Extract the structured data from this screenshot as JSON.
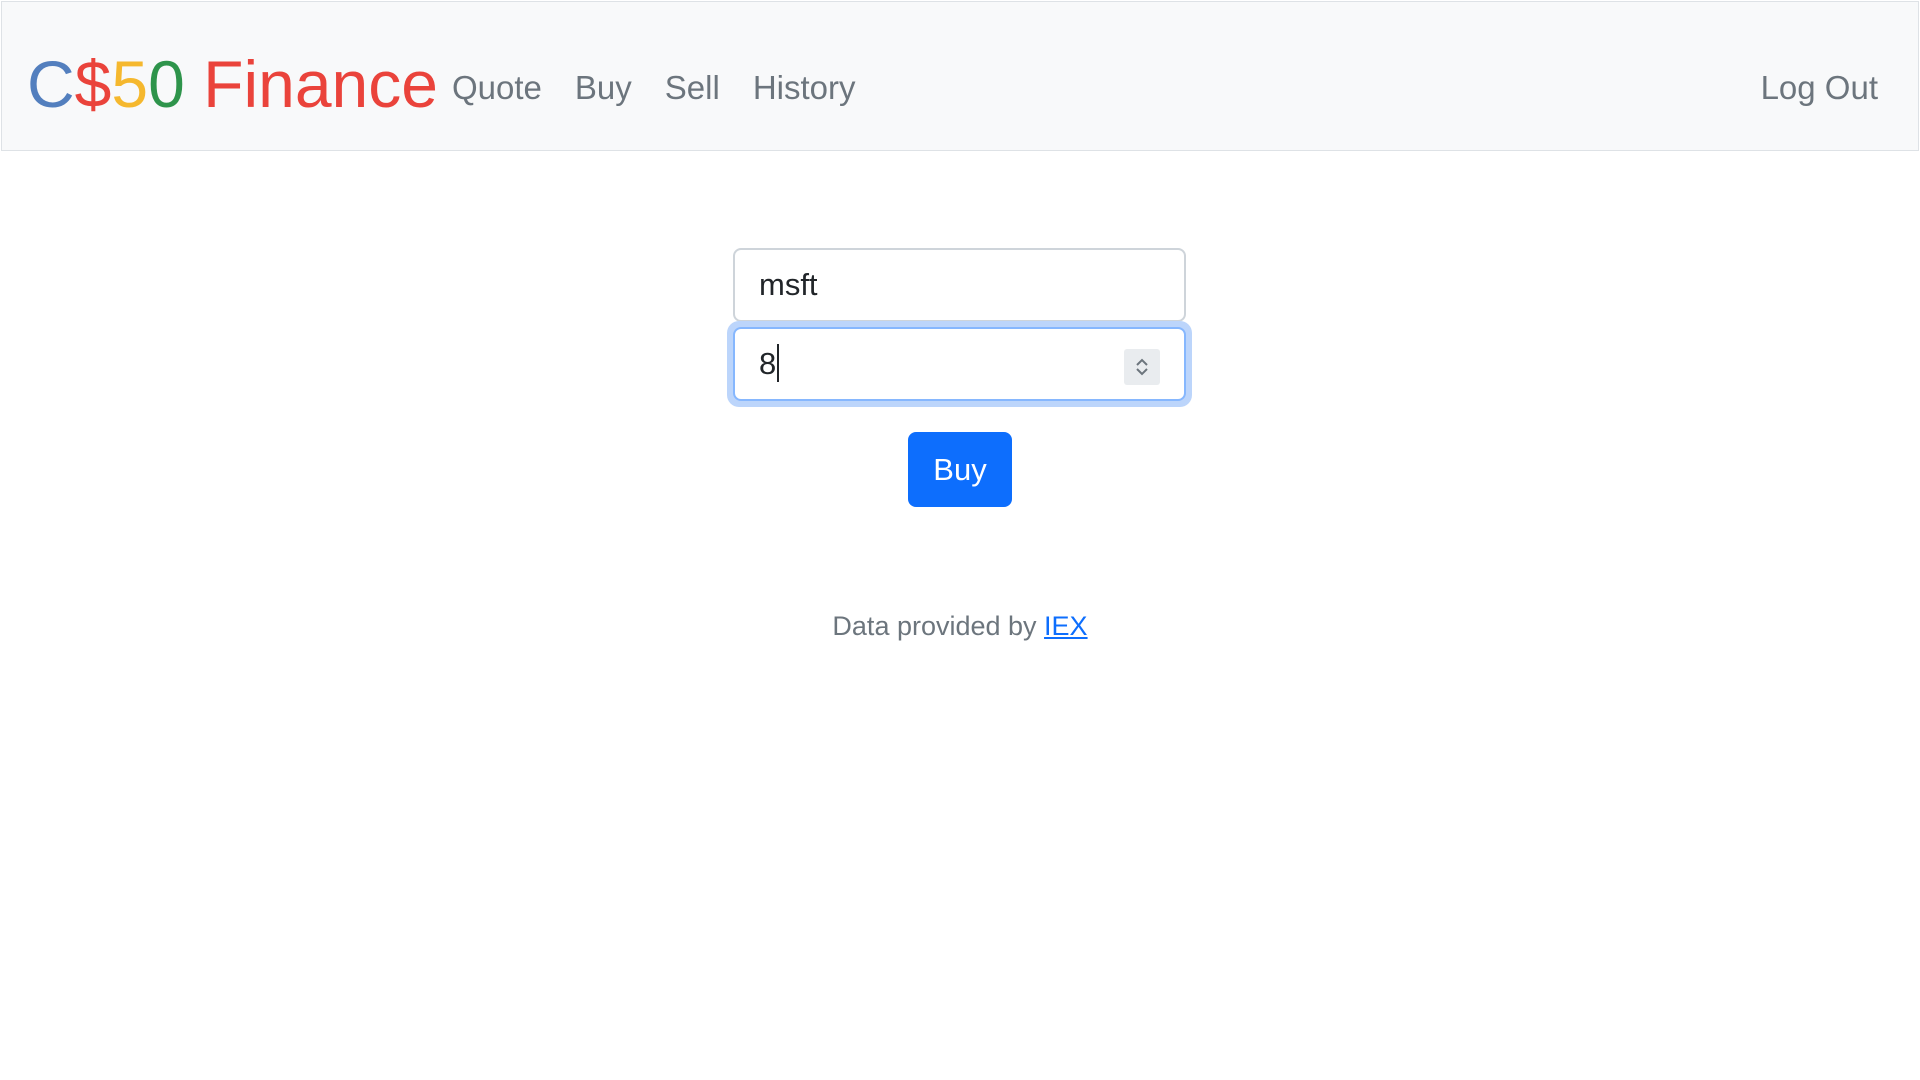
{
  "brand": {
    "parts": [
      {
        "text": "C",
        "color": "#537fbe"
      },
      {
        "text": "$",
        "color": "#ea433b"
      },
      {
        "text": "5",
        "color": "#f5b82e"
      },
      {
        "text": "0",
        "color": "#2e944b"
      },
      {
        "text": " Finance",
        "color": "#ea433b"
      }
    ]
  },
  "nav": {
    "links": [
      "Quote",
      "Buy",
      "Sell",
      "History"
    ],
    "logout": "Log Out"
  },
  "form": {
    "symbol_value": "msft",
    "shares_value": "8",
    "buy_label": "Buy"
  },
  "footer": {
    "text": "Data provided by ",
    "link": "IEX"
  },
  "colors": {
    "primary": "#0d6efd",
    "navbar_bg": "#f8f9fa",
    "muted": "#6c757d"
  }
}
